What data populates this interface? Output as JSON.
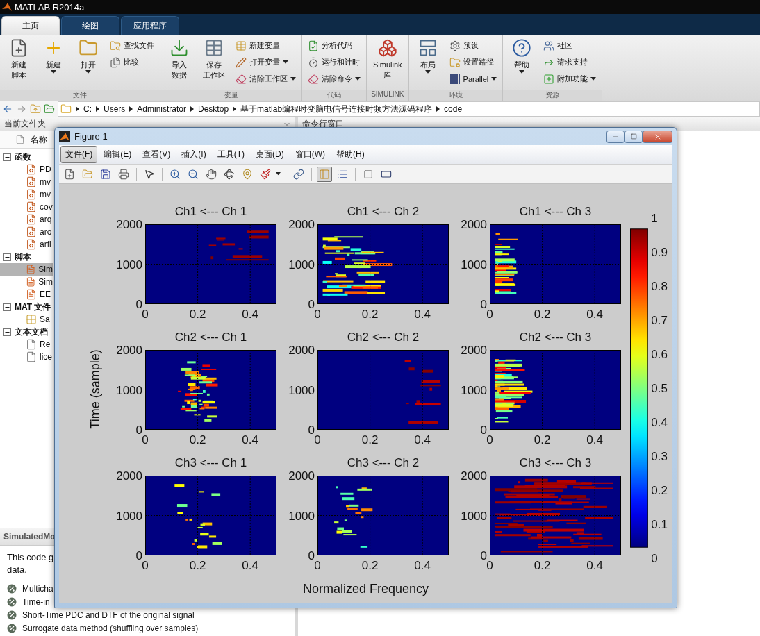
{
  "app": {
    "title": "MATLAB R2014a"
  },
  "ribbon_tabs": [
    {
      "label": "主页",
      "selected": true
    },
    {
      "label": "绘图",
      "selected": false
    },
    {
      "label": "应用程序",
      "selected": false
    }
  ],
  "ribbon_groups": [
    {
      "label": "文件",
      "items": [
        {
          "kind": "large",
          "lines": [
            "新建",
            "脚本"
          ],
          "dropdown": false
        },
        {
          "kind": "large",
          "lines": [
            "新建"
          ],
          "dropdown": true
        },
        {
          "kind": "large",
          "lines": [
            "打开"
          ],
          "dropdown": true
        },
        {
          "kind": "stack",
          "items": [
            {
              "label": "查找文件",
              "dropdown": false
            },
            {
              "label": "比较",
              "dropdown": false
            }
          ]
        }
      ]
    },
    {
      "label": "变量",
      "items": [
        {
          "kind": "large",
          "lines": [
            "导入",
            "数据"
          ],
          "dropdown": false
        },
        {
          "kind": "large",
          "lines": [
            "保存",
            "工作区"
          ],
          "dropdown": false
        },
        {
          "kind": "stack",
          "items": [
            {
              "label": "新建变量",
              "dropdown": false
            },
            {
              "label": "打开变量",
              "dropdown": true
            },
            {
              "label": "清除工作区",
              "dropdown": true
            }
          ]
        }
      ]
    },
    {
      "label": "代码",
      "items": [
        {
          "kind": "stack",
          "items": [
            {
              "label": "分析代码",
              "dropdown": false
            },
            {
              "label": "运行和计时",
              "dropdown": false
            },
            {
              "label": "清除命令",
              "dropdown": true
            }
          ]
        }
      ]
    },
    {
      "label": "SIMULINK",
      "items": [
        {
          "kind": "large",
          "lines": [
            "Simulink",
            "库"
          ],
          "dropdown": false
        }
      ]
    },
    {
      "label": "环境",
      "items": [
        {
          "kind": "large",
          "lines": [
            "布局"
          ],
          "dropdown": true
        },
        {
          "kind": "stack",
          "items": [
            {
              "label": "预设",
              "dropdown": false
            },
            {
              "label": "设置路径",
              "dropdown": false
            },
            {
              "label": "Parallel",
              "dropdown": true
            }
          ]
        }
      ]
    },
    {
      "label": "资源",
      "items": [
        {
          "kind": "large",
          "lines": [
            "帮助"
          ],
          "dropdown": true
        },
        {
          "kind": "stack",
          "items": [
            {
              "label": "社区",
              "dropdown": false
            },
            {
              "label": "请求支持",
              "dropdown": false
            },
            {
              "label": "附加功能",
              "dropdown": true
            }
          ]
        }
      ]
    }
  ],
  "address": {
    "path": [
      "C:",
      "Users",
      "Administrator",
      "Desktop",
      "基于matlab编程时变脑电信号连接时频方法源码程序",
      "code"
    ]
  },
  "file_browser": {
    "title": "当前文件夹",
    "column": "名称",
    "groups": [
      {
        "label": "函数",
        "kind": "function",
        "expanded": true,
        "children": [
          {
            "name": "PD",
            "selected": false
          },
          {
            "name": "mv",
            "selected": false
          },
          {
            "name": "mv",
            "selected": false
          },
          {
            "name": "cov",
            "selected": false
          },
          {
            "name": "arq",
            "selected": false
          },
          {
            "name": "aro",
            "selected": false
          },
          {
            "name": "arfi",
            "selected": false
          }
        ]
      },
      {
        "label": "脚本",
        "kind": "script",
        "expanded": true,
        "children": [
          {
            "name": "Sim",
            "selected": true
          },
          {
            "name": "Sim",
            "selected": false
          },
          {
            "name": "EE",
            "selected": false
          }
        ]
      },
      {
        "label": "MAT 文件",
        "kind": "mat",
        "expanded": true,
        "children": [
          {
            "name": "Sa",
            "selected": false
          }
        ]
      },
      {
        "label": "文本文档",
        "kind": "text",
        "expanded": true,
        "children": [
          {
            "name": "Re",
            "selected": false
          },
          {
            "name": "lice",
            "selected": false
          }
        ]
      }
    ]
  },
  "details": {
    "title": "SimulatedMo",
    "description": [
      "This code g",
      "data."
    ],
    "sections": [
      "Multicha",
      "Time-in",
      "Short-Time  PDC and DTF of the original signal",
      "Surrogate data method (shuffling over samples)"
    ]
  },
  "command_window": {
    "title": "命令行窗口"
  },
  "figure": {
    "title": "Figure 1",
    "menus": [
      {
        "label": "文件(F)",
        "selected": true
      },
      {
        "label": "编辑(E)",
        "selected": false
      },
      {
        "label": "查看(V)",
        "selected": false
      },
      {
        "label": "插入(I)",
        "selected": false
      },
      {
        "label": "工具(T)",
        "selected": false
      },
      {
        "label": "桌面(D)",
        "selected": false
      },
      {
        "label": "窗口(W)",
        "selected": false
      },
      {
        "label": "帮助(H)",
        "selected": false
      }
    ],
    "toolbar_toggles": [
      {
        "selected": true
      },
      {
        "selected": false
      }
    ],
    "subplots": [
      {
        "title": "Ch1 <--- Ch 1",
        "yticks": [
          "2000",
          "1000",
          "0"
        ],
        "xticks": [
          "0",
          "0.2",
          "0.4"
        ]
      },
      {
        "title": "Ch1 <--- Ch 2",
        "yticks": [
          "2000",
          "1000",
          "0"
        ],
        "xticks": [
          "0",
          "0.2",
          "0.4"
        ]
      },
      {
        "title": "Ch1 <--- Ch 3",
        "yticks": [
          "2000",
          "1000",
          "0"
        ],
        "xticks": [
          "0",
          "0.2",
          "0.4"
        ]
      },
      {
        "title": "Ch2 <--- Ch 1",
        "yticks": [
          "2000",
          "1000",
          "0"
        ],
        "xticks": [
          "0",
          "0.2",
          "0.4"
        ]
      },
      {
        "title": "Ch2 <--- Ch 2",
        "yticks": [
          "2000",
          "1000",
          "0"
        ],
        "xticks": [
          "0",
          "0.2",
          "0.4"
        ]
      },
      {
        "title": "Ch2 <--- Ch 3",
        "yticks": [
          "2000",
          "1000",
          "0"
        ],
        "xticks": [
          "0",
          "0.2",
          "0.4"
        ]
      },
      {
        "title": "Ch3 <--- Ch 1",
        "yticks": [
          "2000",
          "1000",
          "0"
        ],
        "xticks": [
          "0",
          "0.2",
          "0.4"
        ]
      },
      {
        "title": "Ch3 <--- Ch 2",
        "yticks": [
          "2000",
          "1000",
          "0"
        ],
        "xticks": [
          "0",
          "0.2",
          "0.4"
        ]
      },
      {
        "title": "Ch3 <--- Ch 3",
        "yticks": [
          "2000",
          "1000",
          "0"
        ],
        "xticks": [
          "0",
          "0.2",
          "0.4"
        ]
      }
    ],
    "ylabel": "Time (sample)",
    "xlabel": "Normalized Frequency",
    "colorbar": {
      "ticks": [
        "1",
        "0.9",
        "0.8",
        "0.7",
        "0.6",
        "0.5",
        "0.4",
        "0.3",
        "0.2",
        "0.1",
        "0"
      ]
    }
  }
}
